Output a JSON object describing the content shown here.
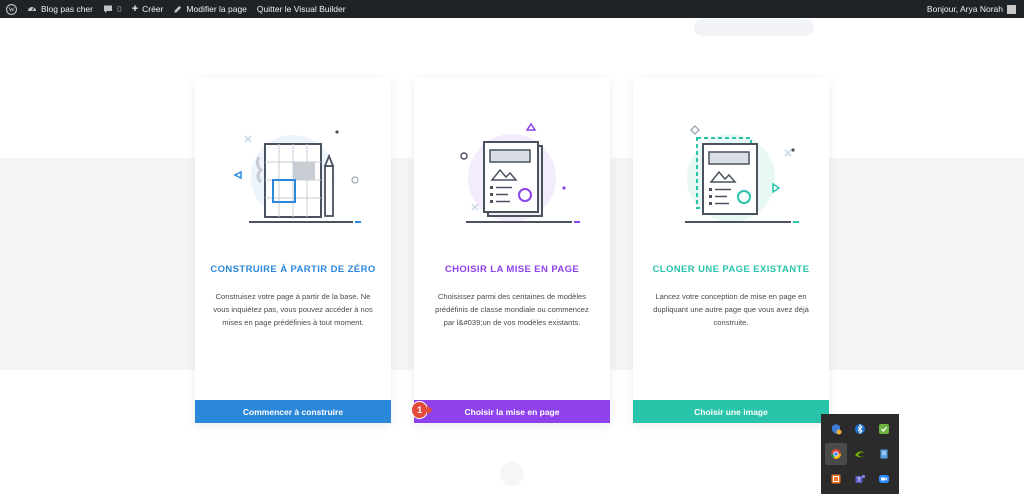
{
  "admin_bar": {
    "site_name": "Blog pas cher",
    "comments_count": "0",
    "create_label": "Créer",
    "edit_label": "Modifier la page",
    "exit_label": "Quitter le Visual Builder",
    "greeting": "Bonjour, Arya Norah"
  },
  "cards": [
    {
      "title": "CONSTRUIRE À PARTIR DE ZÉRO",
      "description": "Construisez votre page à partir de la base. Ne vous inquiétez pas, vous pouvez accéder à nos mises en page prédéfinies à tout moment.",
      "button_label": "Commencer à construire",
      "accent": "#2b87da"
    },
    {
      "title": "CHOISIR LA MISE EN PAGE",
      "description": "Choisissez parmi des centaines de modèles prédéfinis de classe mondiale ou commencez par l&#039;un de vos modèles existants.",
      "button_label": "Choisir la mise en page",
      "accent": "#8f42ec"
    },
    {
      "title": "CLONER UNE PAGE EXISTANTE",
      "description": "Lancez votre conception de mise en page en dupliquant une autre page que vous avez déjà construite.",
      "button_label": "Choisir une image",
      "accent": "#29c4a9"
    }
  ],
  "step_badge": "1",
  "tray": {
    "icons": [
      "shield-alert-icon",
      "bluetooth-icon",
      "security-check-icon",
      "chrome-icon",
      "nvidia-icon",
      "notepad-icon",
      "app-orange-icon",
      "teams-icon",
      "zoom-icon"
    ]
  }
}
